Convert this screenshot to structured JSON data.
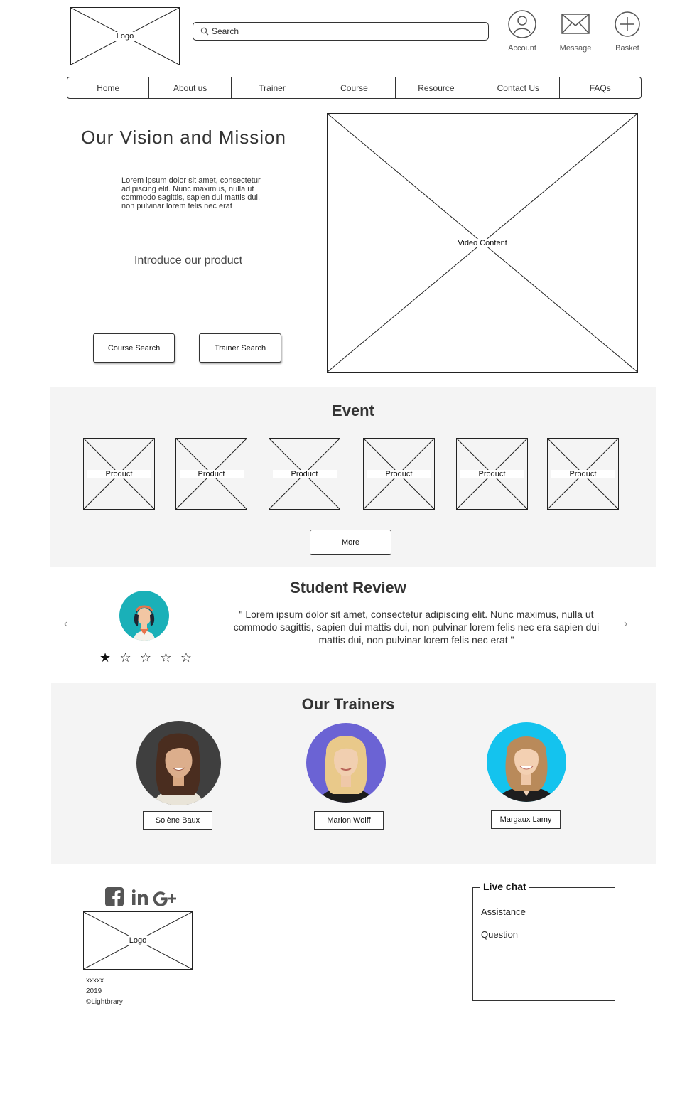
{
  "header": {
    "logo_label": "Logo",
    "search_placeholder": "Search",
    "icons": [
      {
        "icon": "account-icon",
        "label": "Account"
      },
      {
        "icon": "message-icon",
        "label": "Message"
      },
      {
        "icon": "basket-icon",
        "label": "Basket"
      }
    ]
  },
  "nav": {
    "items": [
      "Home",
      "About us",
      "Trainer",
      "Course",
      "Resource",
      "Contact Us",
      "FAQs"
    ]
  },
  "hero": {
    "title": "Our Vision and Mission",
    "text": "Lorem ipsum dolor sit amet, consectetur adipiscing elit. Nunc maximus, nulla ut commodo sagittis, sapien dui mattis dui, non pulvinar lorem felis nec erat",
    "intro": "Introduce our product",
    "course_search": "Course Search",
    "trainer_search": "Trainer Search",
    "video_label": "Video Content"
  },
  "event": {
    "title": "Event",
    "products": [
      "Product",
      "Product",
      "Product",
      "Product",
      "Product",
      "Product"
    ],
    "more": "More"
  },
  "review": {
    "title": "Student Review",
    "quote": "\" Lorem ipsum dolor sit amet, consectetur adipiscing elit. Nunc maximus, nulla ut commodo sagittis, sapien dui mattis dui, non pulvinar lorem felis nec era sapien dui mattis dui, non pulvinar lorem felis nec erat \"",
    "rating": 1,
    "rating_max": 5,
    "prev": "‹",
    "next": "›"
  },
  "trainers": {
    "title": "Our Trainers",
    "people": [
      {
        "name": "Solène Baux",
        "bg": "#3f3f3f"
      },
      {
        "name": "Marion Wolff",
        "bg": "#6b63d4"
      },
      {
        "name": "Margaux Lamy",
        "bg": "#14c3ee"
      }
    ]
  },
  "footer": {
    "logo_label": "Logo",
    "line1": "xxxxx",
    "line2": "2019",
    "line3": "©Lightbrary",
    "social": [
      "facebook-icon",
      "linkedin-icon",
      "google-plus-icon"
    ]
  },
  "live_chat": {
    "title": "Live chat",
    "options": [
      "Assistance",
      "Question"
    ]
  },
  "colors": {
    "band": "#f4f4f4",
    "review_avatar": "#1ab0b8",
    "border": "#333333"
  }
}
